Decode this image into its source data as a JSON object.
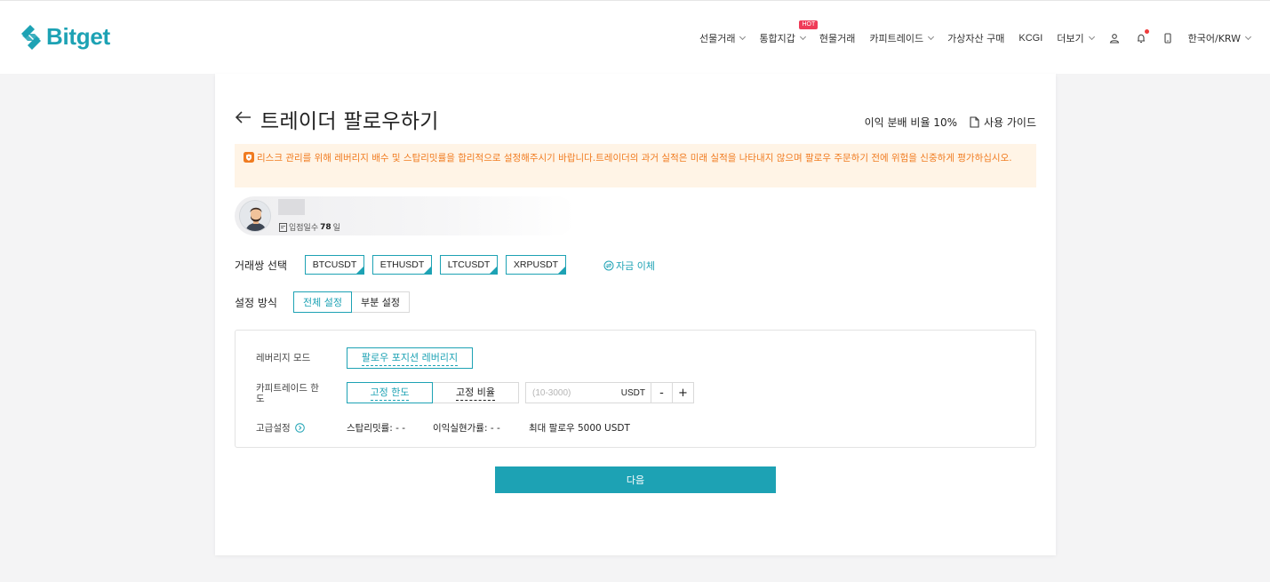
{
  "header": {
    "logo_text": "Bitget",
    "brand_color": "#1da2b4",
    "nav": [
      {
        "label": "선물거래",
        "dropdown": true
      },
      {
        "label": "통합지갑",
        "dropdown": true,
        "badge": "HOT"
      },
      {
        "label": "현물거래",
        "dropdown": false
      },
      {
        "label": "카피트레이드",
        "dropdown": true
      },
      {
        "label": "가상자산 구매",
        "dropdown": false
      },
      {
        "label": "KCGI",
        "dropdown": false
      },
      {
        "label": "더보기",
        "dropdown": true
      }
    ],
    "icons": [
      "user-icon",
      "bell-icon",
      "mobile-icon"
    ],
    "language": "한국어/KRW"
  },
  "page": {
    "title": "트레이더 팔로우하기",
    "profit_share": "이익 분배 비율 10%",
    "guide_label": "사용 가이드",
    "warning": "리스크 관리를 위해 레버리지 배수 및 스탑리밋률을 합리적으로 설정해주시기 바랍니다.트레이더의 과거 실적은 미래 실적을 나타내지 않으며 팔로우 주문하기 전에 위험을 신중하게 평가하십시오.",
    "trader": {
      "days_label": "입점일수",
      "days_value": "78",
      "days_unit": "일"
    },
    "pair_label": "거래쌍 선택",
    "pairs": [
      "BTCUSDT",
      "ETHUSDT",
      "LTCUSDT",
      "XRPUSDT"
    ],
    "transfer_label": "자금 이체",
    "mode_label": "설정 방식",
    "modes": [
      {
        "label": "전체 설정",
        "active": true
      },
      {
        "label": "부분 설정",
        "active": false
      }
    ],
    "settings": {
      "leverage_label": "레버리지 모드",
      "leverage_value": "팔로우 포지션 레버리지",
      "copy_limit_label": "카피트레이드 한도",
      "copy_options": [
        {
          "label": "고정 한도",
          "active": true
        },
        {
          "label": "고정 비율",
          "active": false
        }
      ],
      "amount_placeholder": "(10-3000)",
      "amount_unit": "USDT",
      "minus": "-",
      "plus": "+",
      "advanced_label": "고급설정",
      "stop_loss": "스탑리밋률:  - -",
      "take_profit": "이익실현가률:  - -",
      "max_follow": "최대 팔로우 5000 USDT"
    },
    "next_label": "다음"
  }
}
